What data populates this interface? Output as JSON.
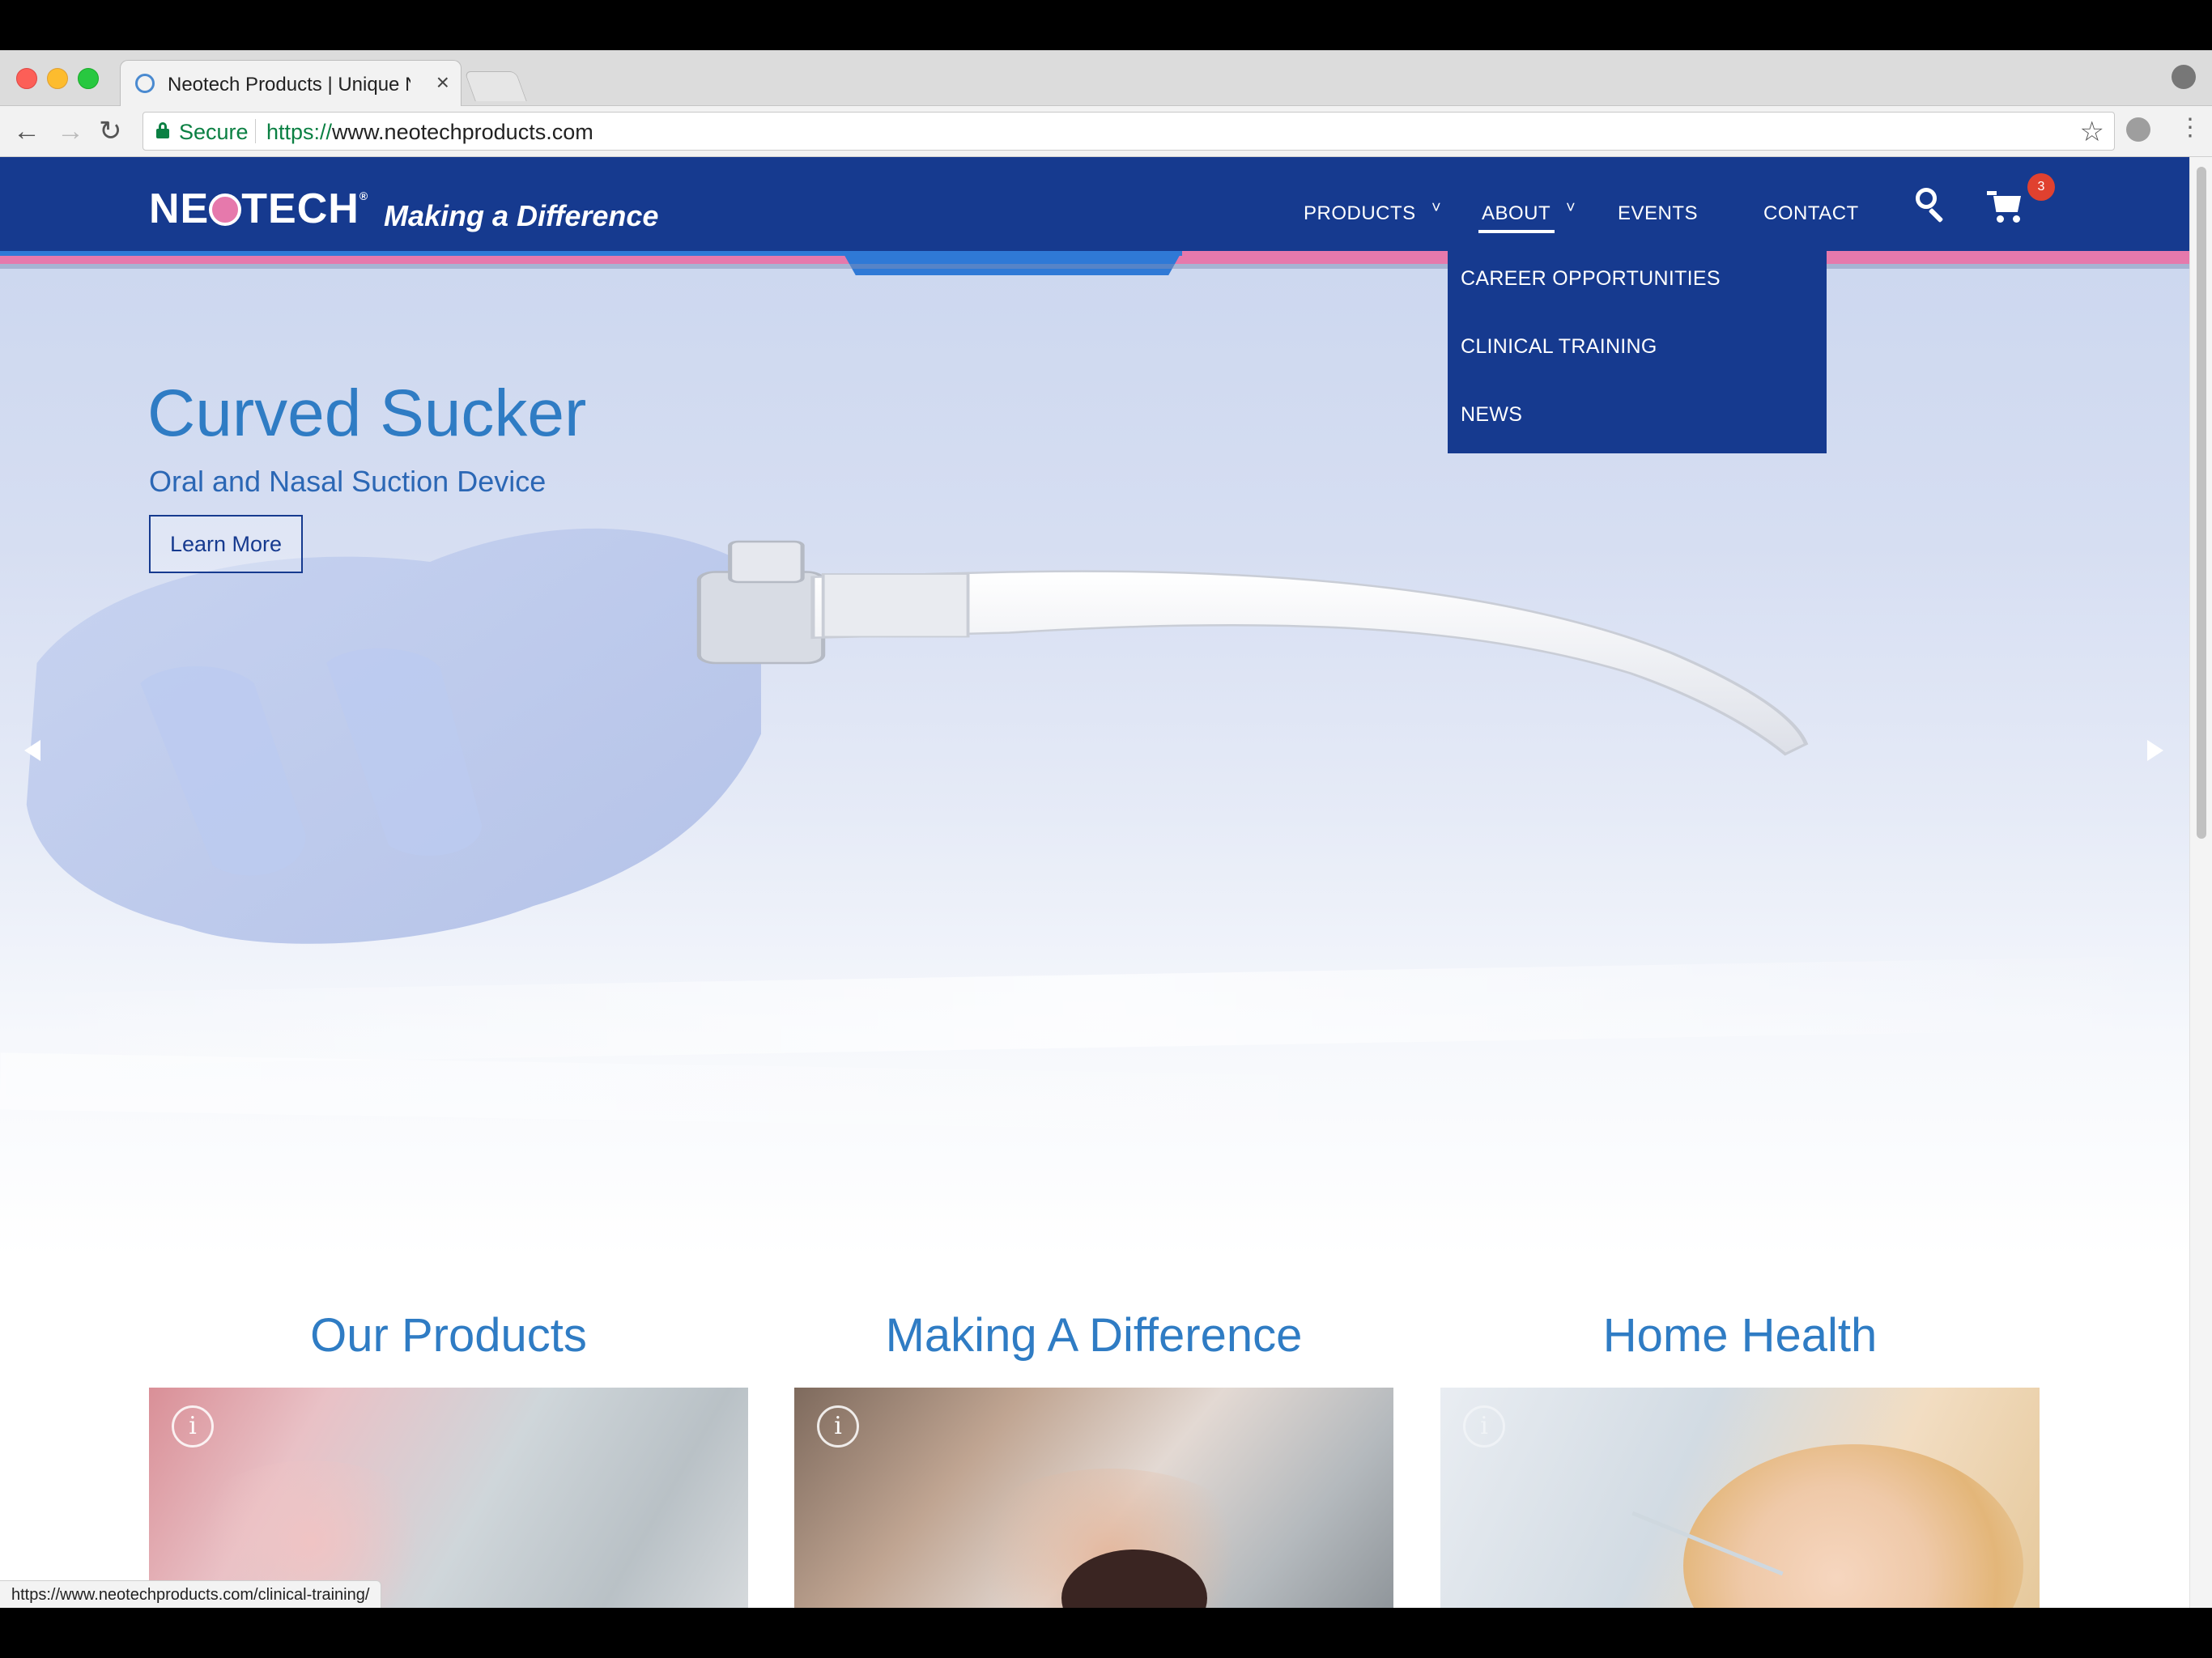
{
  "browser": {
    "tab_title": "Neotech Products | Unique Ne",
    "tab_close": "×",
    "secure_label": "Secure",
    "url_scheme": "https://",
    "url_host": "www.neotechproducts.com",
    "status_url": "https://www.neotechproducts.com/clinical-training/"
  },
  "site": {
    "logo_left": "NE",
    "logo_right": "TECH",
    "logo_tm": "®",
    "tagline": "Making a Difference",
    "nav": {
      "products": "PRODUCTS",
      "about": "ABOUT",
      "events": "EVENTS",
      "contact": "CONTACT",
      "caret": "˅"
    },
    "cart_count": "3",
    "about_menu": [
      "CAREER OPPORTUNITIES",
      "CLINICAL TRAINING",
      "NEWS"
    ]
  },
  "hero": {
    "title": "Curved Sucker",
    "subtitle": "Oral and Nasal Suction Device",
    "button": "Learn More"
  },
  "sections": [
    {
      "heading": "Our Products"
    },
    {
      "heading": "Making A Difference"
    },
    {
      "heading": "Home Health"
    }
  ],
  "icons": {
    "info": "i",
    "back": "←",
    "forward": "→",
    "reload": "↻",
    "star": "☆",
    "menu": "⋮"
  },
  "colors": {
    "nav_bg": "#163a8f",
    "accent_pink": "#e679ac",
    "accent_blue": "#2f79d6",
    "heading_blue": "#2f7cc4",
    "badge_red": "#e0412f"
  }
}
